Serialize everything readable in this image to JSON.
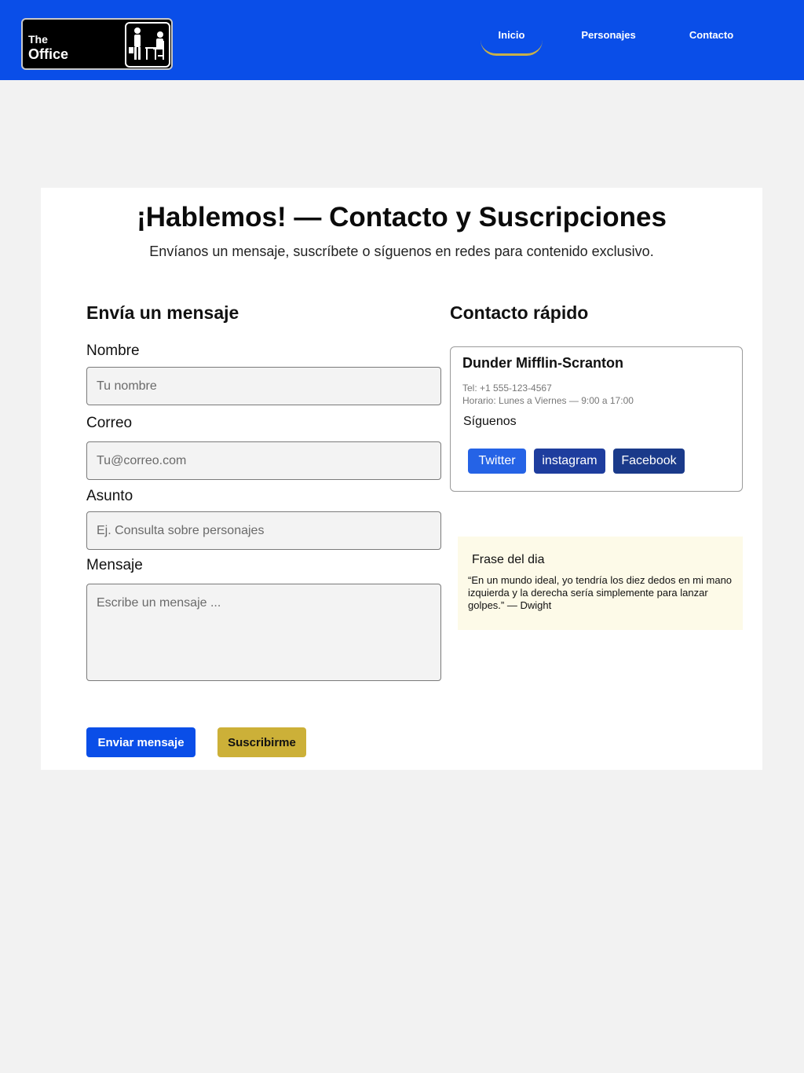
{
  "header": {
    "logo": {
      "line1": "The",
      "line2": "Office"
    },
    "nav": [
      {
        "label": "Inicio",
        "active": true
      },
      {
        "label": "Personajes",
        "active": false
      },
      {
        "label": "Contacto",
        "active": false
      }
    ],
    "bg_color": "#0a4ee8",
    "active_underline_color": "#c8b04a"
  },
  "page": {
    "title": "¡Hablemos! — Contacto y Suscripciones",
    "subtitle": "Envíanos un mensaje, suscríbete o síguenos en redes para contenido exclusivo."
  },
  "form": {
    "heading": "Envía un mensaje",
    "fields": [
      {
        "label": "Nombre",
        "placeholder": "Tu nombre",
        "value": ""
      },
      {
        "label": "Correo",
        "placeholder": "Tu@correo.com",
        "value": ""
      },
      {
        "label": "Asunto",
        "placeholder": "Ej. Consulta sobre personajes",
        "value": ""
      },
      {
        "label": "Mensaje",
        "placeholder": "Escribe un mensaje ...",
        "value": ""
      }
    ],
    "send_label": "Enviar mensaje",
    "subscribe_label": "Suscribirme",
    "send_color": "#0a4ee8",
    "subscribe_color": "#ccb038"
  },
  "quick": {
    "heading": "Contacto rápido",
    "company": "Dunder Mifflin-Scranton",
    "phone": "Tel: +1 555-123-4567",
    "hours": "Horario: Lunes a Viernes — 9:00 a 17:00",
    "follow_label": "Síguenos",
    "social": [
      {
        "label": "Twitter",
        "color": "#2563e6"
      },
      {
        "label": "instagram",
        "color": "#1e3d9e"
      },
      {
        "label": "Facebook",
        "color": "#1a3a8a"
      }
    ]
  },
  "quote": {
    "title": "Frase del dia",
    "text": "“En un mundo ideal, yo tendría los diez dedos en mi mano izquierda y la derecha sería simplemente para lanzar golpes.” —  Dwight"
  }
}
